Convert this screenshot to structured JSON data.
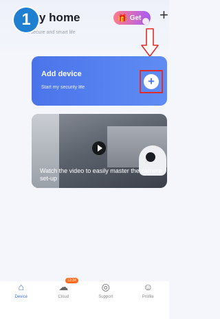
{
  "tutorial": {
    "step_number": "1"
  },
  "header": {
    "title": "y home",
    "subtitle": "e a secure and smart life",
    "get_label": "Get",
    "add_symbol": "+"
  },
  "add_device_card": {
    "title": "Add device",
    "subtitle": "Start my security life",
    "add_symbol": "+"
  },
  "video_card": {
    "caption": "Watch the video to easily master the camera set-up"
  },
  "tabbar": {
    "tabs": [
      {
        "label": "Device",
        "icon": "device-icon",
        "active": true
      },
      {
        "label": "Cloud",
        "icon": "cloud-icon",
        "active": false,
        "badge": "12:34"
      },
      {
        "label": "Support",
        "icon": "support-icon",
        "active": false
      },
      {
        "label": "Profile",
        "icon": "profile-icon",
        "active": false
      }
    ]
  },
  "colors": {
    "accent": "#4b74ea",
    "step_badge": "#1f7fd0",
    "highlight_red": "#e02c2c"
  }
}
